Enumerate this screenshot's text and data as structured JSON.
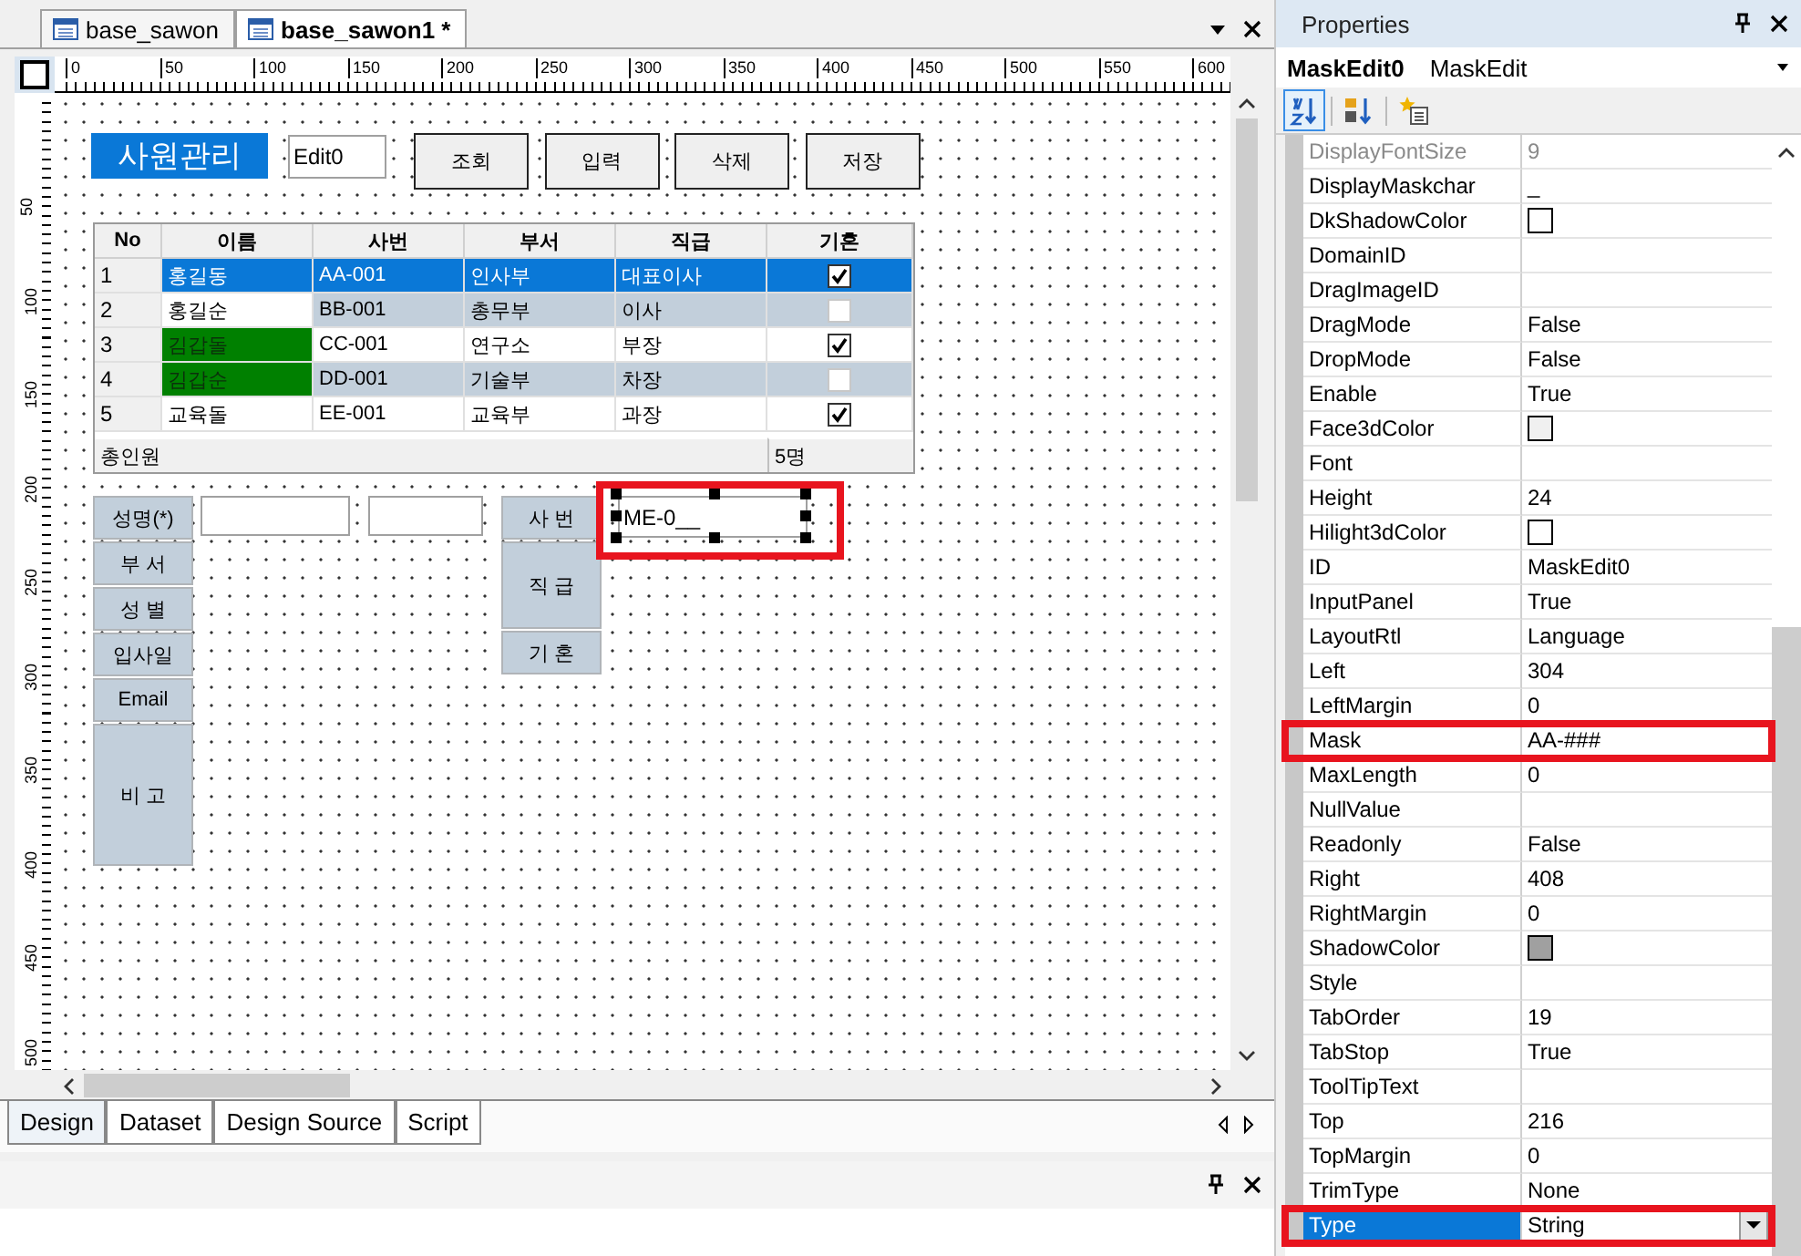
{
  "document_tabs": [
    {
      "label": "base_sawon",
      "selected": false
    },
    {
      "label": "base_sawon1 *",
      "selected": true
    }
  ],
  "ruler": {
    "horizontal": [
      "0",
      "50",
      "100",
      "150",
      "200",
      "250",
      "300",
      "350",
      "400",
      "450",
      "500",
      "550",
      "600"
    ],
    "vertical": [
      "50",
      "100",
      "150",
      "200",
      "250",
      "300",
      "350",
      "400",
      "450",
      "500"
    ]
  },
  "form": {
    "title": "사원관리",
    "edit_field": {
      "value": "Edit0"
    },
    "buttons": [
      "조회",
      "입력",
      "삭제",
      "저장"
    ],
    "grid": {
      "columns": [
        "No",
        "이름",
        "사번",
        "부서",
        "직급",
        "기혼"
      ],
      "rows": [
        {
          "no": "1",
          "name": "홍길동",
          "code": "AA-001",
          "dept": "인사부",
          "rank": "대표이사",
          "married": true,
          "selected": true
        },
        {
          "no": "2",
          "name": "홍길순",
          "code": "BB-001",
          "dept": "총무부",
          "rank": "이사",
          "married": false,
          "selected": false
        },
        {
          "no": "3",
          "name": "김갑돌",
          "code": "CC-001",
          "dept": "연구소",
          "rank": "부장",
          "married": true,
          "selected": false,
          "color": "#008000"
        },
        {
          "no": "4",
          "name": "김갑순",
          "code": "DD-001",
          "dept": "기술부",
          "rank": "차장",
          "married": false,
          "selected": false,
          "color": "#008000"
        },
        {
          "no": "5",
          "name": "교육돌",
          "code": "EE-001",
          "dept": "교육부",
          "rank": "과장",
          "married": true,
          "selected": false
        }
      ],
      "footer": {
        "label": "총인원",
        "count": "5명"
      }
    },
    "labels_left": [
      {
        "text": "성명(*)",
        "kind": "single"
      },
      {
        "text": "부 서",
        "kind": "single"
      },
      {
        "text": "성 별",
        "kind": "single"
      },
      {
        "text": "입사일",
        "kind": "single"
      },
      {
        "text": "Email",
        "kind": "single"
      },
      {
        "text": "비 고",
        "kind": "memo"
      }
    ],
    "labels_right": [
      {
        "text": "사 번",
        "kind": "single"
      },
      {
        "text": "직 급",
        "kind": "double"
      },
      {
        "text": "기 혼",
        "kind": "single"
      }
    ],
    "mask_edit": {
      "value": "ME-0__",
      "selected": true
    }
  },
  "bottom_tabs": [
    {
      "label": "Design",
      "selected": true
    },
    {
      "label": "Dataset",
      "selected": false
    },
    {
      "label": "Design Source",
      "selected": false
    },
    {
      "label": "Script",
      "selected": false
    }
  ],
  "properties": {
    "title": "Properties",
    "object": {
      "name": "MaskEdit0",
      "type": "MaskEdit"
    },
    "toolbar": [
      {
        "kind": "alphabetical",
        "selected": true
      },
      {
        "kind": "categorized",
        "selected": false
      },
      {
        "kind": "events",
        "selected": false
      }
    ],
    "rows": [
      {
        "name": "DisplayFontSize",
        "value": "9",
        "kind": "text",
        "disabled": true,
        "marked": false,
        "selected": false
      },
      {
        "name": "DisplayMaskchar",
        "value": "_",
        "kind": "text",
        "disabled": false,
        "marked": false,
        "selected": false
      },
      {
        "name": "DkShadowColor",
        "kind": "swatch",
        "color": "#ffffff",
        "disabled": false,
        "marked": false,
        "selected": false
      },
      {
        "name": "DomainID",
        "kind": "text",
        "disabled": false,
        "marked": false,
        "selected": false
      },
      {
        "name": "DragImageID",
        "kind": "text",
        "disabled": false,
        "marked": false,
        "selected": false
      },
      {
        "name": "DragMode",
        "value": "False",
        "kind": "text",
        "disabled": false,
        "marked": false,
        "selected": false
      },
      {
        "name": "DropMode",
        "value": "False",
        "kind": "text",
        "disabled": false,
        "marked": false,
        "selected": false
      },
      {
        "name": "Enable",
        "value": "True",
        "kind": "text",
        "disabled": false,
        "marked": false,
        "selected": false
      },
      {
        "name": "Face3dColor",
        "kind": "swatch",
        "color": "#f0f0f0",
        "disabled": false,
        "marked": false,
        "selected": false
      },
      {
        "name": "Font",
        "kind": "text",
        "disabled": false,
        "marked": false,
        "selected": false
      },
      {
        "name": "Height",
        "value": "24",
        "kind": "text",
        "disabled": false,
        "marked": false,
        "selected": false
      },
      {
        "name": "Hilight3dColor",
        "kind": "swatch",
        "color": "#ffffff",
        "disabled": false,
        "marked": false,
        "selected": false
      },
      {
        "name": "ID",
        "value": "MaskEdit0",
        "kind": "text",
        "disabled": false,
        "marked": false,
        "selected": false
      },
      {
        "name": "InputPanel",
        "value": "True",
        "kind": "text",
        "disabled": false,
        "marked": false,
        "selected": false
      },
      {
        "name": "LayoutRtl",
        "value": "Language",
        "kind": "text",
        "disabled": false,
        "marked": false,
        "selected": false
      },
      {
        "name": "Left",
        "value": "304",
        "kind": "text",
        "disabled": false,
        "marked": false,
        "selected": false
      },
      {
        "name": "LeftMargin",
        "value": "0",
        "kind": "text",
        "disabled": false,
        "marked": false,
        "selected": false
      },
      {
        "name": "Mask",
        "value": "AA-###",
        "kind": "text",
        "disabled": false,
        "marked": true,
        "selected": false
      },
      {
        "name": "MaxLength",
        "value": "0",
        "kind": "text",
        "disabled": false,
        "marked": false,
        "selected": false
      },
      {
        "name": "NullValue",
        "kind": "text",
        "disabled": false,
        "marked": false,
        "selected": false
      },
      {
        "name": "Readonly",
        "value": "False",
        "kind": "text",
        "disabled": false,
        "marked": false,
        "selected": false
      },
      {
        "name": "Right",
        "value": "408",
        "kind": "text",
        "disabled": false,
        "marked": false,
        "selected": false
      },
      {
        "name": "RightMargin",
        "value": "0",
        "kind": "text",
        "disabled": false,
        "marked": false,
        "selected": false
      },
      {
        "name": "ShadowColor",
        "kind": "swatch",
        "color": "#a0a0a0",
        "disabled": false,
        "marked": false,
        "selected": false
      },
      {
        "name": "Style",
        "kind": "text",
        "disabled": false,
        "marked": false,
        "selected": false
      },
      {
        "name": "TabOrder",
        "value": "19",
        "kind": "text",
        "disabled": false,
        "marked": false,
        "selected": false
      },
      {
        "name": "TabStop",
        "value": "True",
        "kind": "text",
        "disabled": false,
        "marked": false,
        "selected": false
      },
      {
        "name": "ToolTipText",
        "kind": "text",
        "disabled": false,
        "marked": false,
        "selected": false
      },
      {
        "name": "Top",
        "value": "216",
        "kind": "text",
        "disabled": false,
        "marked": false,
        "selected": false
      },
      {
        "name": "TopMargin",
        "value": "0",
        "kind": "text",
        "disabled": false,
        "marked": false,
        "selected": false
      },
      {
        "name": "TrimType",
        "value": "None",
        "kind": "text",
        "disabled": false,
        "marked": false,
        "selected": false
      },
      {
        "name": "Type",
        "value": "String",
        "kind": "dropdown",
        "disabled": false,
        "marked": true,
        "selected": true
      }
    ]
  }
}
